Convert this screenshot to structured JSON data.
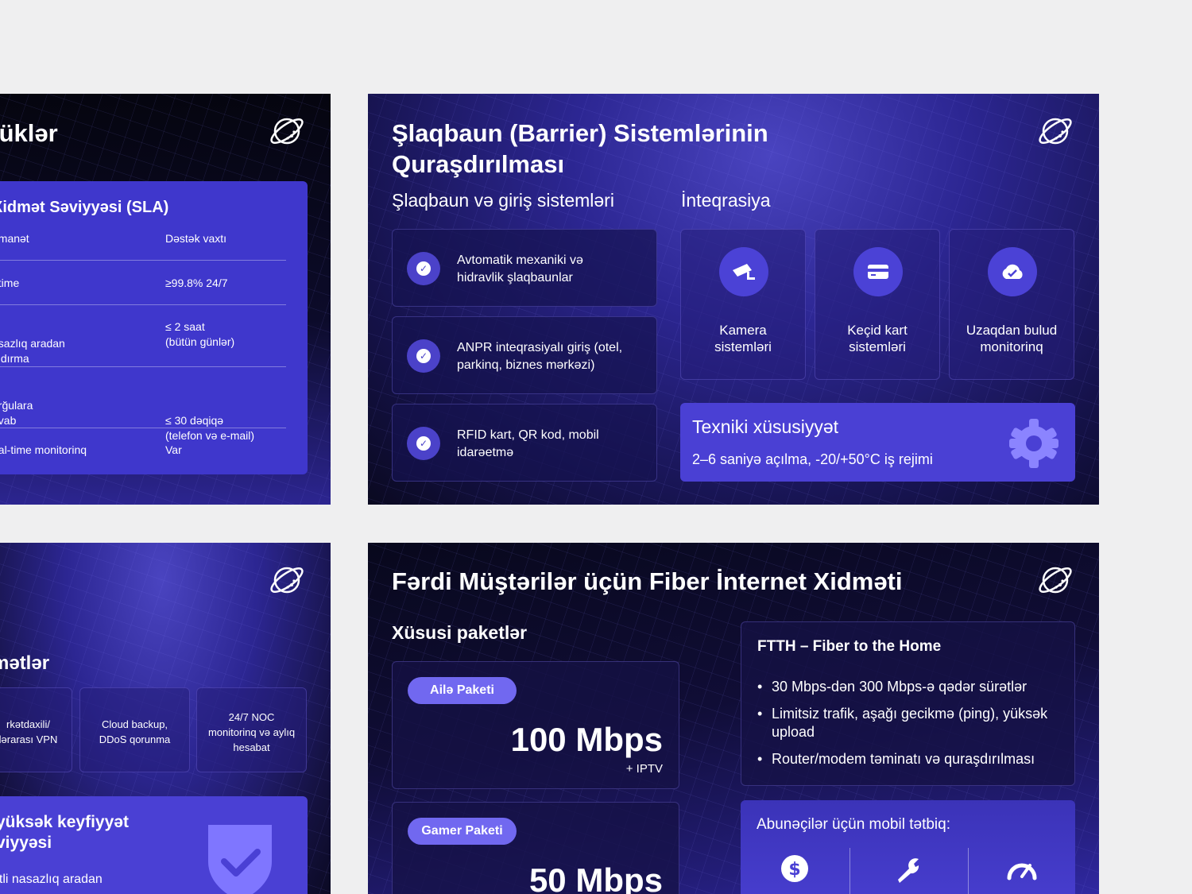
{
  "slide_sla": {
    "title": "lüklər",
    "card_title": "Xidmət Səviyyəsi (SLA)",
    "header": [
      "əmanət",
      "Dəstək vaxtı"
    ],
    "rows": [
      {
        "left": "ptime",
        "right": "≥99.8% 24/7"
      },
      {
        "left": "asazlıq aradan\naldırma",
        "right": "≤ 2 saat\n(bütün günlər)"
      },
      {
        "left": "orğulara\navab",
        "right": "≤ 30 dəqiqə\n(telefon və e-mail)"
      },
      {
        "left": "eal-time monitorinq",
        "right": "Var"
      }
    ]
  },
  "slide_barrier": {
    "title": "Şlaqbaun (Barrier) Sistemlərinin\nQuraşdırılması",
    "left_heading": "Şlaqbaun və giriş sistemləri",
    "right_heading": "İnteqrasiya",
    "items": [
      "Avtomatik mexaniki və\nhidravlik şlaqbaunlar",
      "ANPR inteqrasiyalı giriş (otel,\nparkinq, biznes mərkəzi)",
      "RFID kart, QR kod, mobil\nidarəetmə"
    ],
    "integrations": [
      {
        "label": "Kamera\nsistemləri",
        "icon": "camera-icon"
      },
      {
        "label": "Keçid kart\nsistemləri",
        "icon": "card-icon"
      },
      {
        "label": "Uzaqdan bulud\nmonitorinq",
        "icon": "cloud-check-icon"
      }
    ],
    "spec_title": "Texniki xüsusiyyət",
    "spec_text": "2–6 saniyə açılma, -20/+50°C iş rejimi"
  },
  "slide_services": {
    "title": "mətlər",
    "tiles": [
      "rkətdaxili/\nlərarası VPN",
      "Cloud backup,\nDDoS qorunma",
      "24/7 NOC\nmonitorinq və aylıq\nhesabat"
    ],
    "quality_title": "yüksək keyfiyyət\nviyyəsi",
    "quality_text": "ətli nasazlıq aradan"
  },
  "slide_fiber": {
    "title": "Fərdi Müştərilər üçün Fiber İnternet Xidməti",
    "packages_heading": "Xüsusi paketlər",
    "packages": [
      {
        "name": "Ailə Paketi",
        "speed": "100 Mbps",
        "extra": "+ IPTV"
      },
      {
        "name": "Gamer Paketi",
        "speed": "50 Mbps",
        "extra": ""
      }
    ],
    "ftth_title": "FTTH – Fiber to the Home",
    "ftth_points": [
      "30 Mbps-dən 300 Mbps-ə qədər sürətlər",
      "Limitsiz trafik, aşağı gecikmə (ping), yüksək upload",
      "Router/modem təminatı və quraşdırılması"
    ],
    "app_title": "Abunəçilər üçün mobil tətbiq:",
    "app_icons": [
      "dollar-icon",
      "wrench-icon",
      "speedometer-icon"
    ]
  },
  "colors": {
    "accent": "#4a40d4",
    "pill": "#7168f0",
    "background": "#efeff0"
  }
}
